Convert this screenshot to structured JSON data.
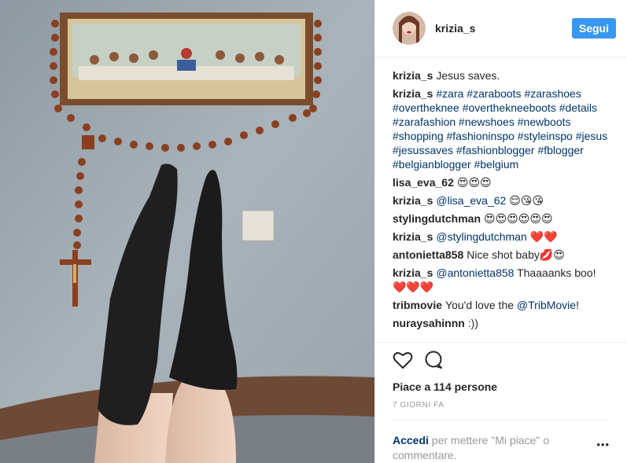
{
  "post": {
    "username": "krizia_s",
    "follow_label": "Segui",
    "caption": "Jesus saves.",
    "likes_text": "Piace a 114 persone",
    "time_text": "7 GIORNI FA",
    "add_comment_link": "Accedi",
    "add_comment_rest": " per mettere \"Mi piace\" o commentare.",
    "more_label": "•••"
  },
  "comments": [
    {
      "user": "krizia_s",
      "text": "#zara #zaraboots #zarashoes #overtheknee #overthekneeboots #details #zarafashion #newshoes #newboots #shopping #fashioninspo #styleinspo #jesus #jesussaves #fashionblogger #fblogger #belgianblogger #belgium"
    },
    {
      "user": "lisa_eva_62",
      "text": "😍😍😍"
    },
    {
      "user": "krizia_s",
      "mention": "@lisa_eva_62",
      "text": " 😌😘😘"
    },
    {
      "user": "stylingdutchman",
      "text": "😍😍😍😍😍😍"
    },
    {
      "user": "krizia_s",
      "mention": "@stylingdutchman",
      "text": " ❤️❤️"
    },
    {
      "user": "antonietta858",
      "text": "Nice shot baby💋😍"
    },
    {
      "user": "krizia_s",
      "mention": "@antonietta858",
      "text": " Thaaaanks boo! ❤️❤️❤️"
    },
    {
      "user": "tribmovie",
      "text": "You'd love the ",
      "mention2": "@TribMovie",
      "text2": "!"
    },
    {
      "user": "nuraysahinnn",
      "text": ":))"
    }
  ],
  "colors": {
    "accent": "#3897f0",
    "link": "#003569",
    "muted": "#999999"
  },
  "icons": [
    "heart-icon",
    "comment-icon"
  ]
}
